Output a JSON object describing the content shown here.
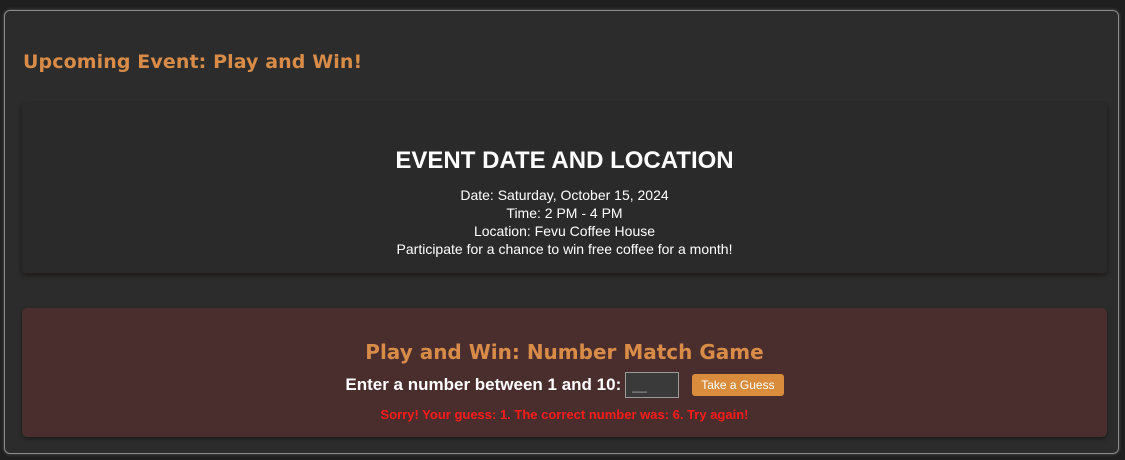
{
  "section": {
    "title": "Upcoming Event: Play and Win!"
  },
  "event": {
    "heading": "EVENT DATE AND LOCATION",
    "date": "Date: Saturday, October 15, 2024",
    "time": "Time: 2 PM - 4 PM",
    "location": "Location: Fevu Coffee House",
    "prize": "Participate for a chance to win free coffee for a month!"
  },
  "game": {
    "title": "Play and Win: Number Match Game",
    "prompt": "Enter a number between 1 and 10:",
    "input_placeholder": "__",
    "input_value": "",
    "button_label": "Take a Guess",
    "result": "Sorry! Your guess: 1. The correct number was: 6. Try again!"
  },
  "colors": {
    "accent": "#d88c48",
    "error": "#ff1a1a",
    "game_background": "#4a2e2e",
    "panel_background": "#2c2c2c"
  }
}
